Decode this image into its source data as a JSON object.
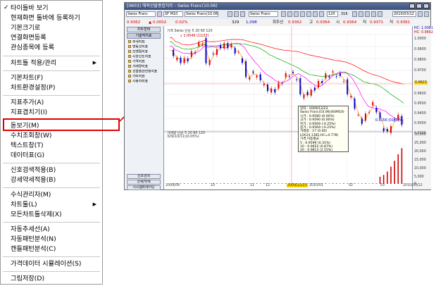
{
  "menu": {
    "items": [
      {
        "label": "타이틀바 보기",
        "checked": true
      },
      {
        "label": "현재화면 툴바에 등록하기"
      },
      {
        "label": "기본크기로"
      },
      {
        "label": "연결화면등록"
      },
      {
        "label": "관심종목에 등록"
      },
      {
        "label": "차트틀 적용/관리",
        "submenu": true
      },
      {
        "label": "기본차트(F)"
      },
      {
        "label": "차트환경설정(P)"
      },
      {
        "label": "지표추가(A)"
      },
      {
        "label": "지표겹치기(I)"
      },
      {
        "label": "돋보기(M)",
        "highlighted": true
      },
      {
        "label": "수치조회창(W)"
      },
      {
        "label": "텍스트창(T)"
      },
      {
        "label": "데이터표(G)"
      },
      {
        "label": "신호검색적용(B)"
      },
      {
        "label": "강세약세적용(B)"
      },
      {
        "label": "수식관리자(M)"
      },
      {
        "label": "차트툴(L)",
        "submenu": true
      },
      {
        "label": "모든차트툴삭제(X)"
      },
      {
        "label": "자동추세선(A)"
      },
      {
        "label": "자동패턴분석(N)"
      },
      {
        "label": "캔들패턴분석(C)"
      },
      {
        "label": "가격데이터 시뮬레이션(S)"
      },
      {
        "label": "그림저장(D)"
      }
    ]
  },
  "window": {
    "title": "[0603] 해외선물종합차트 - Swiss Franc(10.06)",
    "symbol": "SF M10",
    "symbol_name": "Swiss Franc(10.06)",
    "search_box": "Swiss Franc",
    "count_box": "120",
    "count_total": "316",
    "date_box": "2010/03/12",
    "info": {
      "price": "0.9362",
      "change": "▲ 0.0002",
      "pct": "0.02%",
      "volume": "329",
      "vol_change": "1,098",
      "label_close": "회주선",
      "close": "0.9362",
      "label_high": "고",
      "high": "0.9364",
      "label_open": "시",
      "open": "0.9364",
      "label_low": "저",
      "low": "0.9371",
      "label_last": "저",
      "last": "0.9361"
    },
    "sidebar": {
      "header": "차트형태",
      "tab": "기술적지표",
      "items": [
        "추세지표",
        "변동성지표",
        "모멘텀지표",
        "시장강도지표",
        "가격지표",
        "거래량지표",
        "선물옵션전용지표",
        "기타지표",
        "사용자지표"
      ],
      "bottom_buttons": [
        "신호검색",
        "강세/약세",
        "시스템트레이딩"
      ]
    },
    "price_legend": "가격 Swiss 단순 5 20 60 120",
    "price_note": "↓ 1.0049 (11/27)",
    "low_note": "0.9156 (01/18)",
    "tooltip": {
      "lines": [
        "일자 : 2009/12/23",
        "Swiss Franc(10.06)(60M10)",
        "시가 : 0.9580 (0.00%)",
        "고가 : 0.9590 (0.00%)",
        "저가 : 0.9569 (-0.25%)",
        "종가 : 0.9569 (-0.25%)",
        "거래량 : 17 (0.00)",
        "LOG(4.1382,HC=4.778)",
        "가격 이동평균",
        "5 : 0.9599 (0.31%)",
        "10 : 0.9652 (0.87%)",
        "20 : 0.9813 (2.55%)",
        "60 : 0.9818 (2.60%)",
        "120 : 0.9635 (0.69%)"
      ]
    },
    "volume_legend": "거래량 단순 5 20 60 120",
    "volume_note": "329(10/11)(0.05%)",
    "y_labels_price": [
      "1.0000",
      "0.9900",
      "0.9800",
      "0.9700",
      "0.9600",
      "0.9500",
      "0.9400",
      "0.9300",
      "0.9200"
    ],
    "y_labels_volume": [
      "30,000",
      "25,000",
      "20,000",
      "15,000",
      "10,000",
      "5,000",
      "0"
    ],
    "y_top_labels": [
      "HC: 1.0081",
      "HC: 0.9662"
    ],
    "y_marker_label": "0.9623",
    "x_labels": [
      "2009/09",
      "10",
      "11",
      "12",
      "2009/12/23",
      "2010/01",
      "02",
      "03",
      "2010/03/12"
    ]
  },
  "chart_data": {
    "type": "candlestick",
    "price_range": [
      0.915,
      1.005
    ],
    "volume_range": [
      0,
      30000
    ],
    "ma_periods": [
      5,
      20,
      60,
      120
    ],
    "ma_colors": [
      "#ff9900",
      "#ff00ff",
      "#00aa00",
      "#ff0000"
    ],
    "colors": {
      "up": "#e00000",
      "down": "#0000d0",
      "volume": "#d00000",
      "accent": "#e00000"
    }
  }
}
